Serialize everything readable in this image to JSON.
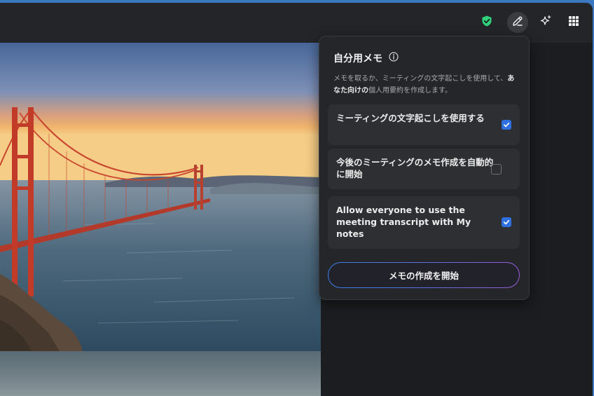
{
  "toolbar": {
    "icons": [
      "shield-check-icon",
      "pencil-icon",
      "sparkle-icon",
      "apps-grid-icon"
    ],
    "shield_color": "#2ed17a"
  },
  "notes_panel": {
    "title": "自分用メモ",
    "desc_part1": "メモを取るか、ミーティングの文字起こしを使用して、",
    "desc_bold": "あなた向けの",
    "desc_part2": "個人用要約を作成します。",
    "options": [
      {
        "label": "ミーティングの文字起こしを使用する",
        "checked": true
      },
      {
        "label": "今後のミーティングのメモ作成を自動的に開始",
        "checked": false
      },
      {
        "label": "Allow everyone to use the meeting transcript with My notes",
        "checked": true
      }
    ],
    "start_button": "メモの作成を開始"
  },
  "colors": {
    "accent": "#2f6fe0",
    "panel_bg": "#252629",
    "option_bg": "#2e2f33"
  }
}
